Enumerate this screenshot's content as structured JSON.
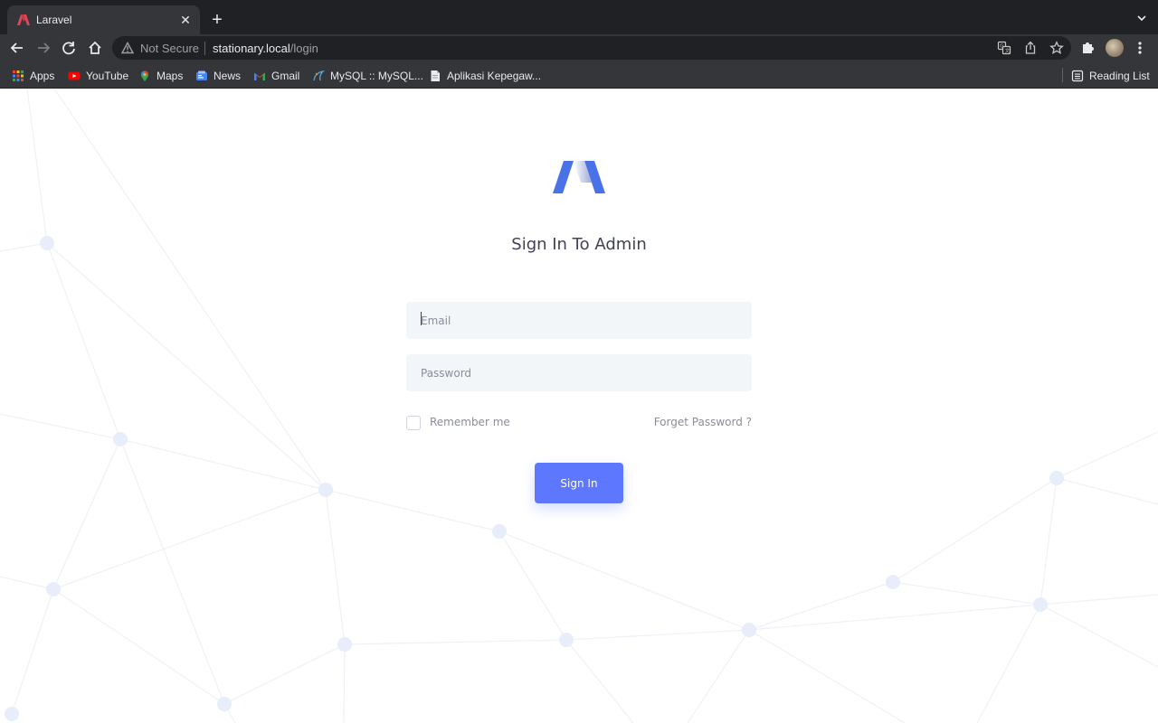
{
  "browser": {
    "tab_title": "Laravel",
    "tab_close": "✕",
    "new_tab": "+",
    "omnibox": {
      "security_label": "Not Secure",
      "host": "stationary.local",
      "path": "/login"
    },
    "bookmarks": [
      {
        "label": "Apps",
        "icon": "apps-grid-icon"
      },
      {
        "label": "YouTube",
        "icon": "youtube-icon"
      },
      {
        "label": "Maps",
        "icon": "maps-icon"
      },
      {
        "label": "News",
        "icon": "news-icon"
      },
      {
        "label": "Gmail",
        "icon": "gmail-icon"
      },
      {
        "label": "MySQL :: MySQL...",
        "icon": "mysql-icon"
      },
      {
        "label": "Aplikasi Kepegaw...",
        "icon": "document-icon"
      }
    ],
    "reading_list": "Reading List"
  },
  "login": {
    "title": "Sign In To Admin",
    "email_placeholder": "Email",
    "email_value": "",
    "password_placeholder": "Password",
    "password_value": "",
    "remember_label": "Remember me",
    "remember_checked": false,
    "forgot_label": "Forget Password ?",
    "submit_label": "Sign In"
  },
  "colors": {
    "accent": "#5d78ff",
    "title": "#3f4254",
    "input_bg": "#f3f6f9",
    "muted_text": "#8a8d98",
    "network_bg": "#eef2fb"
  }
}
